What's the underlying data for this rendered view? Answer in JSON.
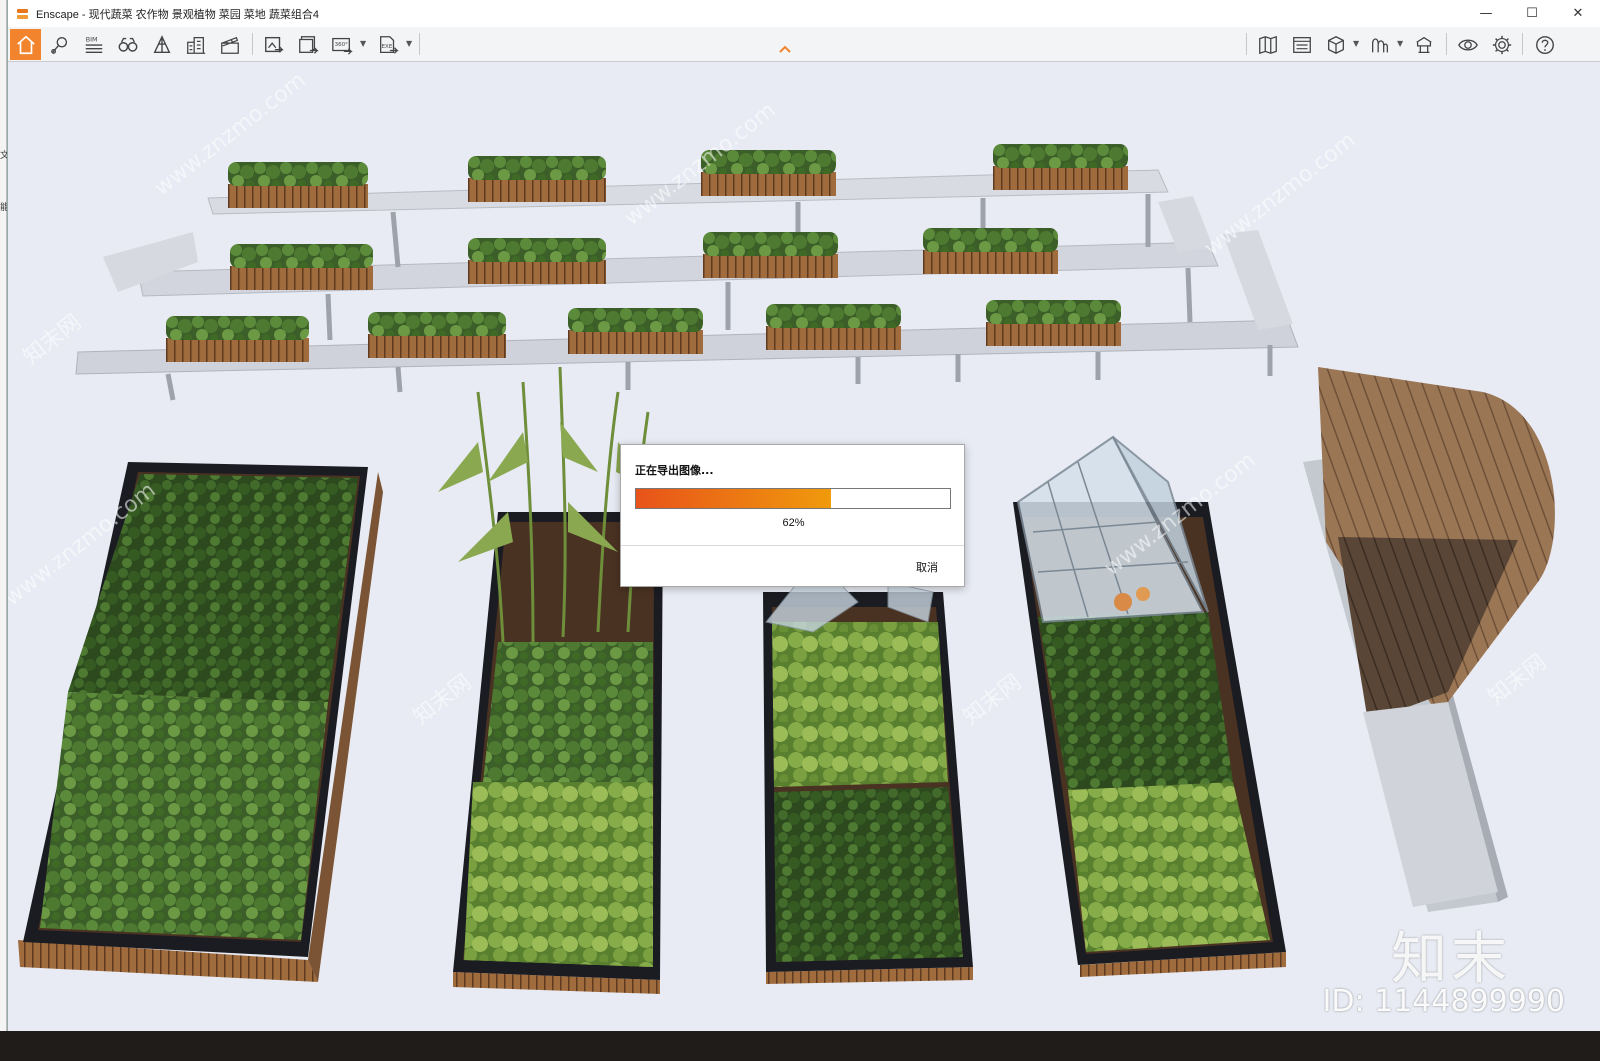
{
  "window": {
    "app_name": "Enscape",
    "title": "Enscape - 现代蔬菜 农作物 景观植物 菜园 菜地 蔬菜组合4",
    "controls": {
      "minimize": "—",
      "maximize": "☐",
      "close": "✕"
    }
  },
  "toolbar": {
    "left_tools": [
      "home-icon",
      "location-pin-icon",
      "bim-icon",
      "binoculars-icon",
      "perspective-icon",
      "buildings-icon",
      "clapper-icon"
    ],
    "export_tools": [
      "screenshot-icon",
      "batch-render-icon",
      "panorama-360-icon",
      "export-exe-icon"
    ],
    "labels": {
      "bim": "BIM",
      "pano": "360°",
      "exe": "EXE"
    },
    "right_tools": [
      "map-icon",
      "assets-icon",
      "cube-icon",
      "sun-icon",
      "library-icon",
      "eye-icon",
      "gear-icon",
      "help-icon"
    ],
    "accent_color": "#f1842c"
  },
  "dialog": {
    "title": "正在导出图像...",
    "progress_value": 0.62,
    "progress_text": "62%",
    "cancel_label": "取消"
  },
  "watermarks": {
    "site": "www.znzmo.com",
    "site_cn": "知末网",
    "brand": "知末",
    "id": "ID: 1144899990"
  },
  "left_strip_chars": [
    "文",
    "能"
  ]
}
